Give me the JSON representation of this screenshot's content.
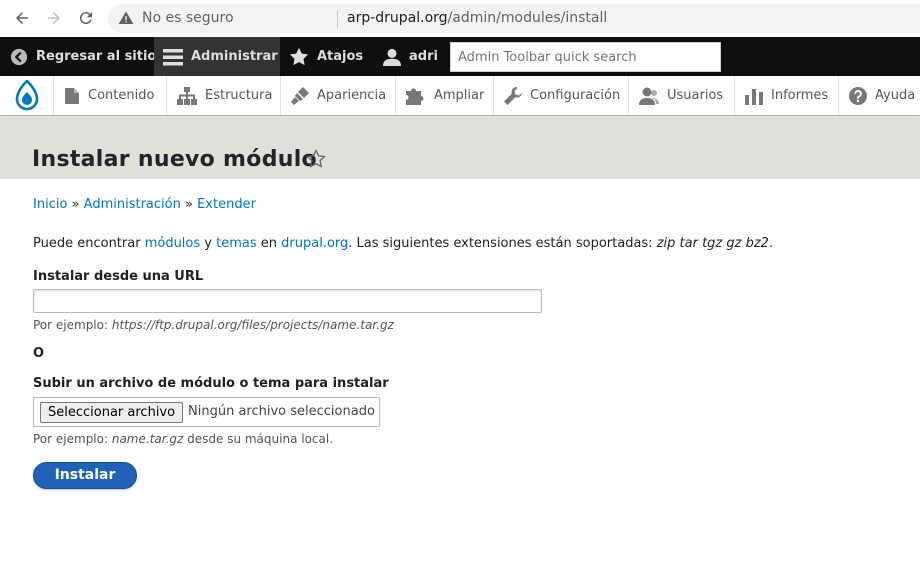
{
  "browser": {
    "insecure_label": "No es seguro",
    "url_host": "arp-drupal.org",
    "url_path": "/admin/modules/install"
  },
  "admin_bar": {
    "back_label": "Regresar al sitio",
    "manage_label": "Administrar",
    "shortcuts_label": "Atajos",
    "user_label": "adri",
    "search_placeholder": "Admin Toolbar quick search"
  },
  "tray": {
    "items": [
      {
        "label": "Contenido",
        "icon": "file-icon"
      },
      {
        "label": "Estructura",
        "icon": "sitemap-icon"
      },
      {
        "label": "Apariencia",
        "icon": "paintbrush-icon"
      },
      {
        "label": "Ampliar",
        "icon": "puzzle-icon"
      },
      {
        "label": "Configuración",
        "icon": "wrench-icon"
      },
      {
        "label": "Usuarios",
        "icon": "people-icon"
      },
      {
        "label": "Informes",
        "icon": "bar-chart-icon"
      },
      {
        "label": "Ayuda",
        "icon": "help-icon"
      }
    ]
  },
  "page": {
    "title": "Instalar nuevo módulo",
    "breadcrumb": [
      "Inicio",
      "Administración",
      "Extender"
    ],
    "breadcrumb_sep": "»",
    "intro": {
      "prefix": "Puede encontrar ",
      "link_modules": "módulos",
      "and": " y ",
      "link_themes": "temas",
      "in": " en ",
      "link_drupal": "drupal.org",
      "suffix": ". Las siguientes extensiones están soportadas: ",
      "formats": "zip tar tgz gz bz2",
      "end": "."
    },
    "url_label": "Instalar desde una URL",
    "url_value": "",
    "url_example_prefix": "Por ejemplo: ",
    "url_example": "https://ftp.drupal.org/files/projects/name.tar.gz",
    "or_label": "O",
    "upload_label": "Subir un archivo de módulo o tema para instalar",
    "file_button": "Seleccionar archivo",
    "file_status": "Ningún archivo seleccionado",
    "upload_example_prefix": "Por ejemplo: ",
    "upload_example": "name.tar.gz",
    "upload_example_suffix": " desde su máquina local.",
    "submit_label": "Instalar"
  },
  "colors": {
    "link": "#0074bd",
    "admin_bar": "#0f0f0f",
    "header_bg": "#e0e0d8",
    "primary_button": "#1f62b8"
  }
}
